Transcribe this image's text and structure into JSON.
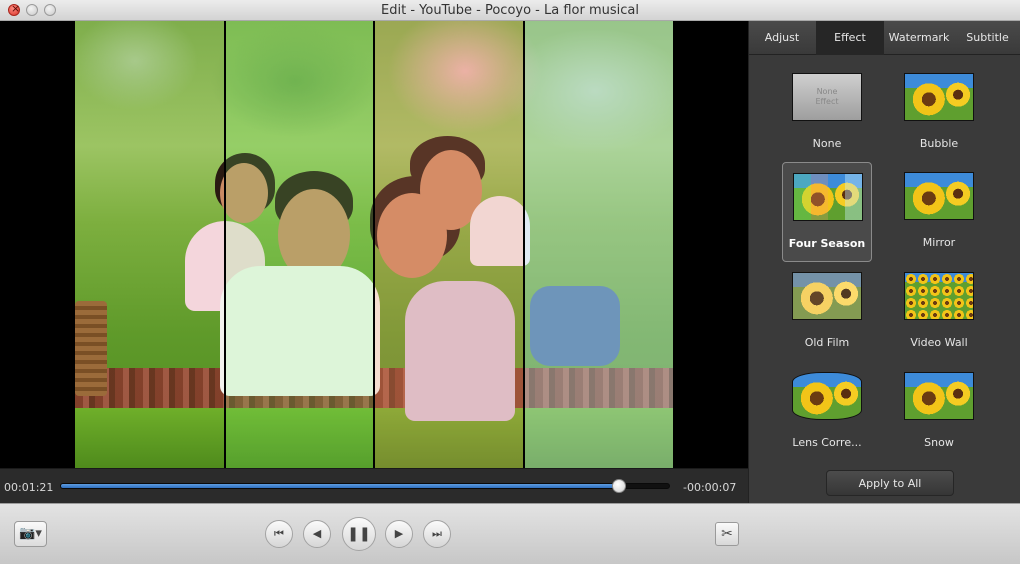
{
  "window": {
    "title": "Edit - YouTube - Pocoyo - La flor musical"
  },
  "player": {
    "elapsed": "00:01:21",
    "remaining": "-00:00:07",
    "progress_fraction": 0.917
  },
  "panel": {
    "tabs": [
      {
        "label": "Adjust",
        "active": false
      },
      {
        "label": "Effect",
        "active": true
      },
      {
        "label": "Watermark",
        "active": false
      },
      {
        "label": "Subtitle",
        "active": false
      }
    ],
    "effects": [
      {
        "label": "None",
        "thumb_text": "None\nEffect",
        "selected": false
      },
      {
        "label": "Bubble",
        "selected": false
      },
      {
        "label": "Four Season",
        "selected": true
      },
      {
        "label": "Mirror",
        "selected": false
      },
      {
        "label": "Old Film",
        "selected": false
      },
      {
        "label": "Video Wall",
        "selected": false
      },
      {
        "label": "Lens Corre...",
        "selected": false
      },
      {
        "label": "Snow",
        "selected": false
      }
    ],
    "apply_label": "Apply to All"
  },
  "toolbar": {
    "snapshot_icon": "camera-icon",
    "buttons": [
      {
        "name": "skip-to-start",
        "icon": "skip-start-icon",
        "glyph": "⏮"
      },
      {
        "name": "step-back",
        "icon": "step-back-icon",
        "glyph": "◀"
      },
      {
        "name": "pause",
        "icon": "pause-icon",
        "glyph": "❚❚"
      },
      {
        "name": "step-forward",
        "icon": "step-forward-icon",
        "glyph": "▶"
      },
      {
        "name": "skip-to-end",
        "icon": "skip-end-icon",
        "glyph": "⏭"
      }
    ],
    "cut_icon": "scissors-icon"
  },
  "colors": {
    "progress_fill": "#3f7fcf",
    "panel_bg": "#3a3a3a",
    "active_tab_bg": "#262626"
  }
}
